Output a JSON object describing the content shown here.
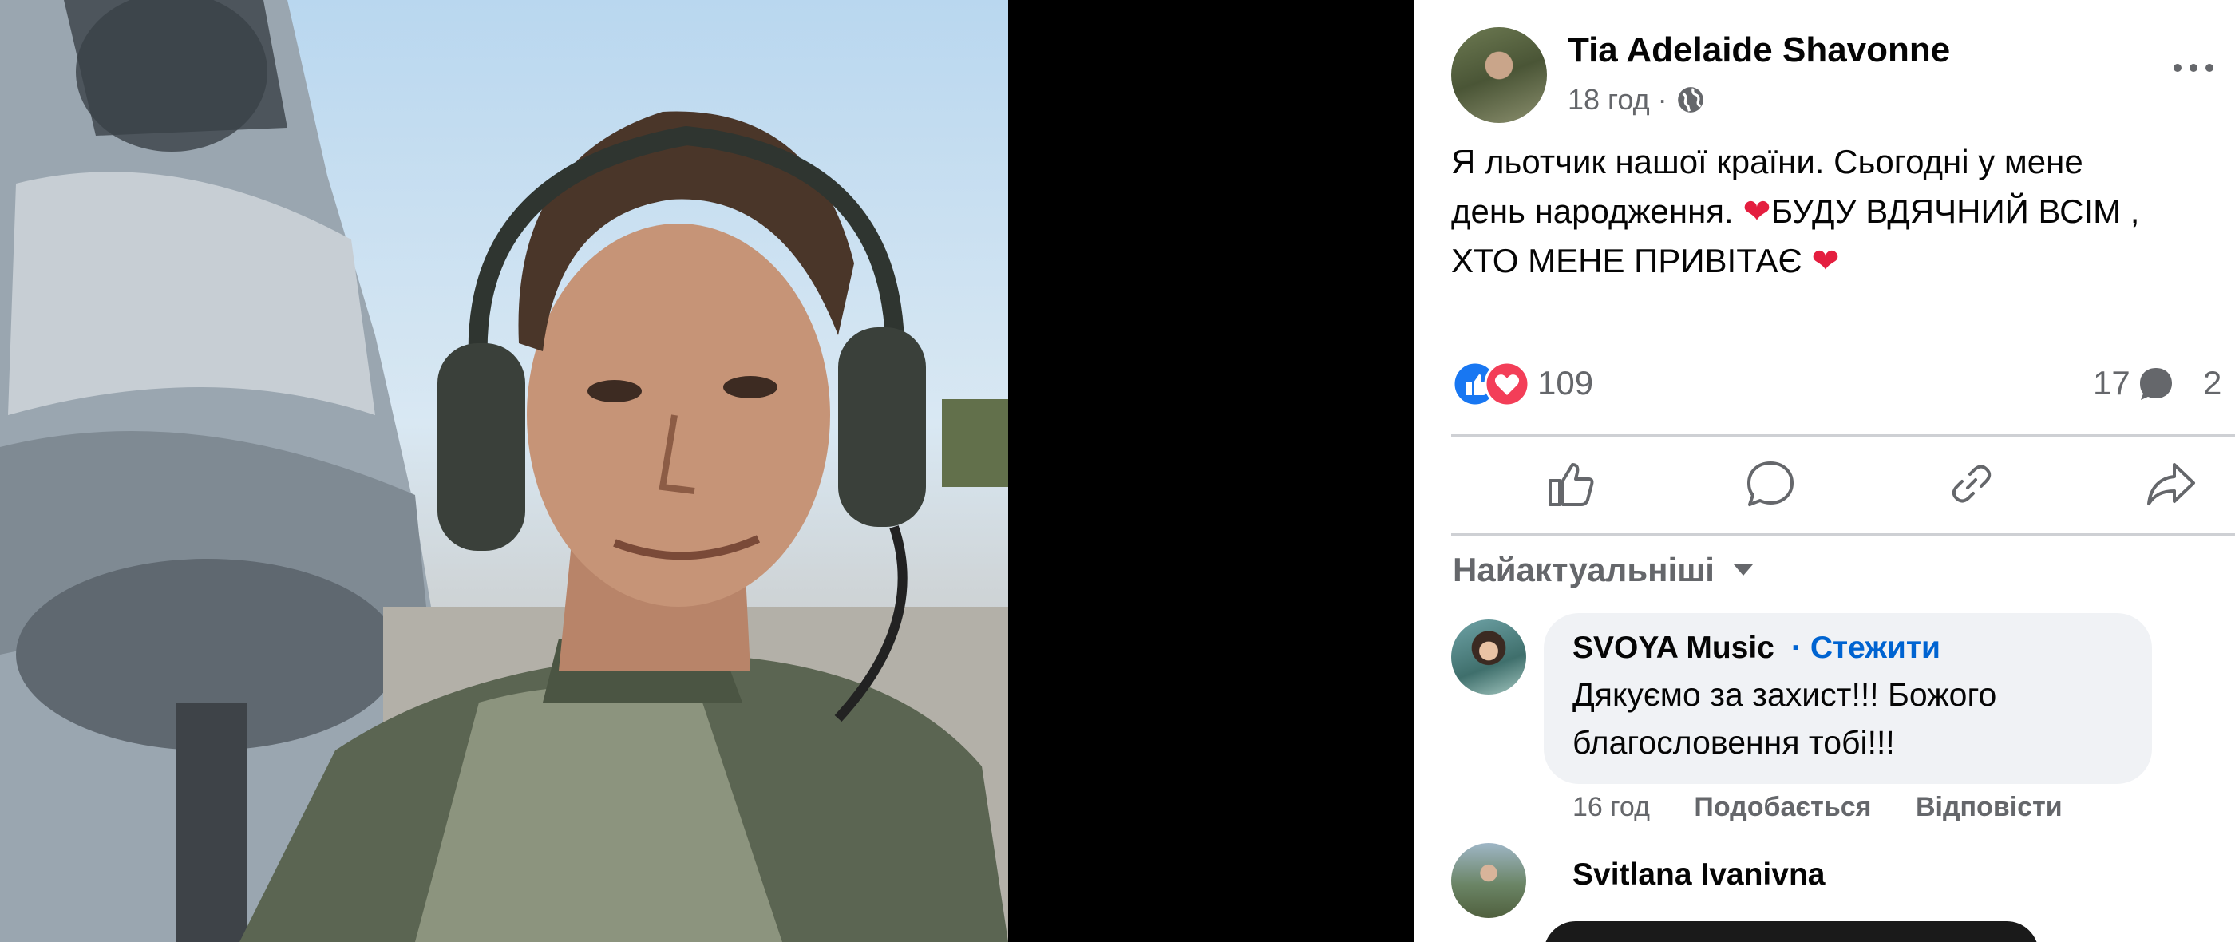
{
  "post": {
    "author": "Tia Adelaide Shavonne",
    "time": "18 год",
    "separator": "·",
    "text_line1": "Я льотчик нашої країни. Сьогодні у мене",
    "text_line2a": "день народження. ",
    "text_line2b": "БУДУ ВДЯЧНИЙ ВСІМ ,",
    "text_line3a": "ХТО МЕНЕ ПРИВІТАЄ ",
    "heart_glyph": "❤"
  },
  "reactions": {
    "count": "109",
    "comments": "17",
    "shares": "2",
    "like_color": "#1877f2",
    "love_color": "#f33e58"
  },
  "actions": {
    "icons": [
      "like-icon",
      "comment-icon",
      "link-icon",
      "share-icon"
    ]
  },
  "comments": {
    "sort_label": "Найактуальніші",
    "items": [
      {
        "author": "SVOYA Music",
        "follow": "· Стежити",
        "text_line1": "Дякуємо за захист!!! Божого",
        "text_line2": "благословення тобі!!!",
        "time": "16 год",
        "like_label": "Подобається",
        "reply_label": "Відповісти"
      },
      {
        "author": "Svitlana Ivanivna"
      }
    ]
  },
  "colors": {
    "link": "#0064d1",
    "muted": "#65676b",
    "divider": "#ced0d4",
    "bubble": "#f0f2f5"
  }
}
